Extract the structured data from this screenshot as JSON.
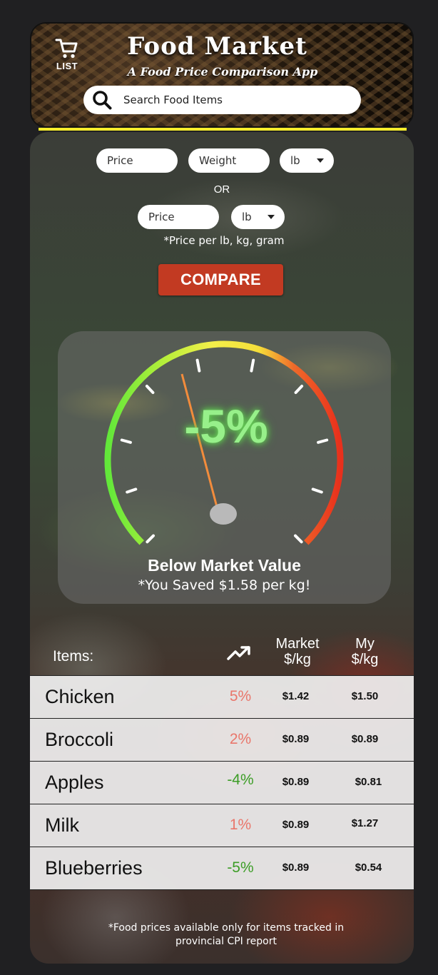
{
  "header": {
    "cart_label": "LIST",
    "title": "Food Market",
    "subtitle": "A Food Price Comparison App",
    "search_placeholder": "Search Food Items"
  },
  "form": {
    "price_placeholder": "Price",
    "weight_placeholder": "Weight",
    "unit_selected": "lb",
    "or_label": "OR",
    "price2_placeholder": "Price",
    "unit2_selected": "lb",
    "note": "*Price per lb, kg, gram",
    "compare_label": "COMPARE"
  },
  "gauge": {
    "percent_label": "-5%",
    "percent_value": -5,
    "status": "Below Market Value",
    "saved": "*You Saved $1.58 per kg!"
  },
  "table": {
    "items_label": "Items:",
    "trend_icon": "trending-up-icon",
    "market_header_1": "Market",
    "market_header_2": "$/kg",
    "my_header_1": "My",
    "my_header_2": "$/kg",
    "rows": [
      {
        "name": "Chicken",
        "change": "5%",
        "market": "$1.42",
        "my": "$1.50",
        "dir": "up"
      },
      {
        "name": "Broccoli",
        "change": "2%",
        "market": "$0.89",
        "my": "$0.89",
        "dir": "up"
      },
      {
        "name": "Apples",
        "change": "-4%",
        "market": "$0.89",
        "my": "$0.81",
        "dir": "down"
      },
      {
        "name": "Milk",
        "change": "1%",
        "market": "$0.89",
        "my": "$1.27",
        "dir": "up"
      },
      {
        "name": "Blueberries",
        "change": "-5%",
        "market": "$0.89",
        "my": "$0.54",
        "dir": "down"
      }
    ]
  },
  "footnote": "*Food prices available only for items tracked in provincial CPI report",
  "colors": {
    "accent_line": "#f6ec2c",
    "compare_button": "#c23a22",
    "increase_text": "#e9766b",
    "decrease_text": "#3c9d26"
  }
}
